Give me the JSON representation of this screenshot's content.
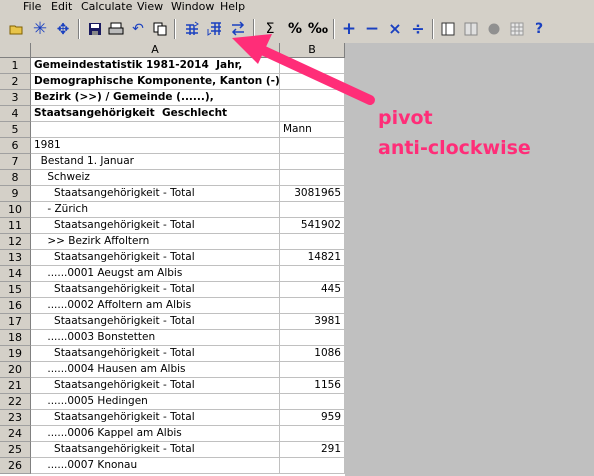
{
  "menu": [
    "File",
    "Edit",
    "Calculate",
    "View",
    "Window",
    "Help"
  ],
  "toolbar": {
    "sigma": "Σ",
    "percent": "%",
    "permille": "‰",
    "plus": "+",
    "minus": "−",
    "times": "×",
    "divide": "÷",
    "help": "?"
  },
  "columns": {
    "row_header": "",
    "a": "A",
    "b": "B"
  },
  "rows": [
    {
      "n": "1",
      "a": "Gemeindestatistik 1981-2014  Jahr,",
      "b": "",
      "bold": true
    },
    {
      "n": "2",
      "a": "Demographische Komponente, Kanton (-) /",
      "b": "",
      "bold": true
    },
    {
      "n": "3",
      "a": "Bezirk (>>) / Gemeinde (......),",
      "b": "",
      "bold": true
    },
    {
      "n": "4",
      "a": "Staatsangehörigkeit  Geschlecht",
      "b": "",
      "bold": true
    },
    {
      "n": "5",
      "a": "",
      "b": "Mann",
      "bold": false,
      "bleft": true
    },
    {
      "n": "6",
      "a": "1981",
      "b": "",
      "bold": false
    },
    {
      "n": "7",
      "a": "  Bestand 1. Januar",
      "b": "",
      "bold": false
    },
    {
      "n": "8",
      "a": "    Schweiz",
      "b": "",
      "bold": false
    },
    {
      "n": "9",
      "a": "      Staatsangehörigkeit - Total",
      "b": "3081965",
      "bold": false
    },
    {
      "n": "10",
      "a": "    - Zürich",
      "b": "",
      "bold": false
    },
    {
      "n": "11",
      "a": "      Staatsangehörigkeit - Total",
      "b": "541902",
      "bold": false
    },
    {
      "n": "12",
      "a": "    >> Bezirk Affoltern",
      "b": "",
      "bold": false
    },
    {
      "n": "13",
      "a": "      Staatsangehörigkeit - Total",
      "b": "14821",
      "bold": false
    },
    {
      "n": "14",
      "a": "    ......0001 Aeugst am Albis",
      "b": "",
      "bold": false
    },
    {
      "n": "15",
      "a": "      Staatsangehörigkeit - Total",
      "b": "445",
      "bold": false
    },
    {
      "n": "16",
      "a": "    ......0002 Affoltern am Albis",
      "b": "",
      "bold": false
    },
    {
      "n": "17",
      "a": "      Staatsangehörigkeit - Total",
      "b": "3981",
      "bold": false
    },
    {
      "n": "18",
      "a": "    ......0003 Bonstetten",
      "b": "",
      "bold": false
    },
    {
      "n": "19",
      "a": "      Staatsangehörigkeit - Total",
      "b": "1086",
      "bold": false
    },
    {
      "n": "20",
      "a": "    ......0004 Hausen am Albis",
      "b": "",
      "bold": false
    },
    {
      "n": "21",
      "a": "      Staatsangehörigkeit - Total",
      "b": "1156",
      "bold": false
    },
    {
      "n": "22",
      "a": "    ......0005 Hedingen",
      "b": "",
      "bold": false
    },
    {
      "n": "23",
      "a": "      Staatsangehörigkeit - Total",
      "b": "959",
      "bold": false
    },
    {
      "n": "24",
      "a": "    ......0006 Kappel am Albis",
      "b": "",
      "bold": false
    },
    {
      "n": "25",
      "a": "      Staatsangehörigkeit - Total",
      "b": "291",
      "bold": false
    },
    {
      "n": "26",
      "a": "    ......0007 Knonau",
      "b": "",
      "bold": false
    }
  ],
  "annotation": {
    "line1": "pivot",
    "line2": "anti-clockwise",
    "color": "#ff2d78"
  }
}
